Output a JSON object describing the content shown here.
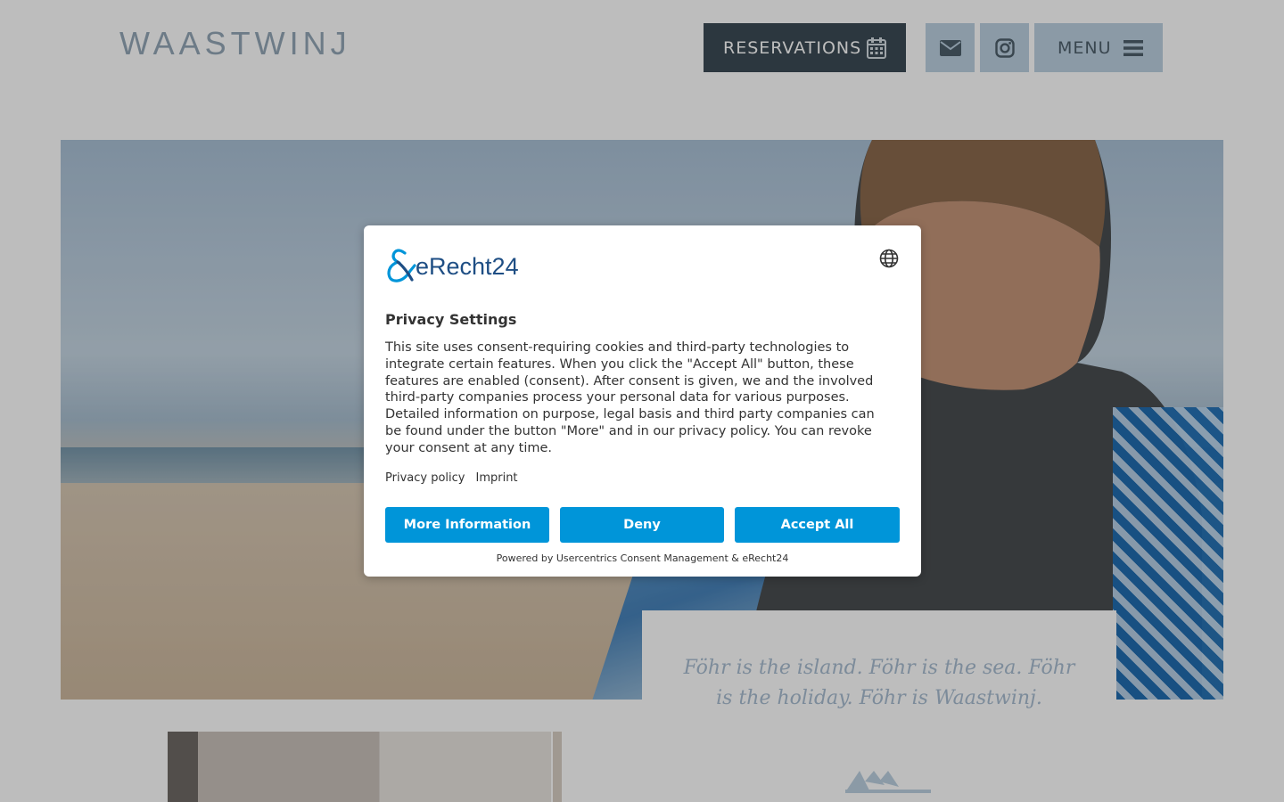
{
  "header": {
    "logo_text": "WAASTWINJ",
    "reservations_label": "RESERVATIONS",
    "reservations_icon": "calendar-icon",
    "mail_icon": "envelope-icon",
    "instagram_icon": "instagram-icon",
    "menu_label": "MENU",
    "menu_icon": "hamburger-icon"
  },
  "hero": {
    "description_colors": {
      "sky": "#aac1d6",
      "sand": "#cdb89e",
      "chair": "#1f6fb5"
    }
  },
  "quote": {
    "text": "Föhr is the island. Föhr is the sea. Föhr is the holiday. Föhr is Waastwinj.",
    "color": "#a8bcd0"
  },
  "consent": {
    "brand": "eRecht24",
    "language_icon": "globe-icon",
    "title": "Privacy Settings",
    "body": "This site uses consent-requiring cookies and third-party technologies to integrate certain features. When you click the \"Accept All\" button, these features are enabled (consent). After consent is given, we and the involved third-party companies process your personal data for various purposes. Detailed information on purpose, legal basis and third party companies can be found under the button \"More\" and in our privacy policy. You can revoke your consent at any time.",
    "links": {
      "privacy_policy": "Privacy policy",
      "imprint": "Imprint"
    },
    "buttons": {
      "more": "More Information",
      "deny": "Deny",
      "accept": "Accept All"
    },
    "footer": "Powered by Usercentrics Consent Management & eRecht24",
    "accent_color": "#0095d9"
  }
}
